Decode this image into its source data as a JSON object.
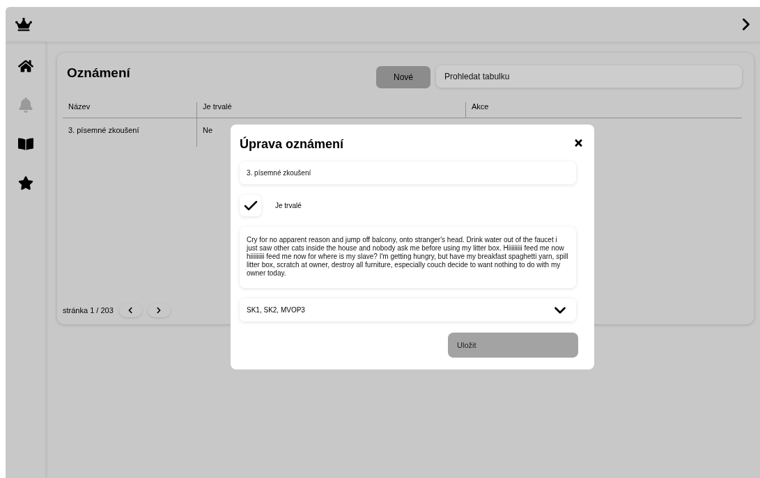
{
  "sidebar": {
    "items": [
      {
        "kind": "home",
        "selected": false
      },
      {
        "kind": "bell",
        "selected": true
      },
      {
        "kind": "book",
        "selected": false
      },
      {
        "kind": "star",
        "selected": false
      }
    ]
  },
  "page": {
    "title": "Oznámení",
    "new_button": "Nové",
    "search": {
      "placeholder": "Prohledat tabulku"
    }
  },
  "table": {
    "columns": [
      "Název",
      "Je trvalé",
      "Akce"
    ],
    "rows": [
      {
        "cells": [
          "3. písemné zkoušení",
          "Ne"
        ]
      }
    ]
  },
  "pagination": {
    "label": "stránka 1 / 203"
  },
  "dialog": {
    "title": "Úprava oznámení",
    "name": "3. písemné zkoušení",
    "permanent": {
      "label": "Je trvalé",
      "checked": true
    },
    "text": "Cry for no apparent reason and jump off balcony, onto stranger's head. Drink water out of the faucet i just saw other cats inside the house and nobody ask me before using my litter box. Hiiiiiiiii feed me now hiiiiiiiii feed me now for where is my slave? I'm getting hungry, but have my breakfast spaghetti yarn, spill litter box, scratch at owner, destroy all furniture, especially couch decide to want nothing to do with my owner today.",
    "groups": "SK1, SK2, MVOP3",
    "save": {
      "label": "Uložit",
      "disabled": true
    }
  }
}
